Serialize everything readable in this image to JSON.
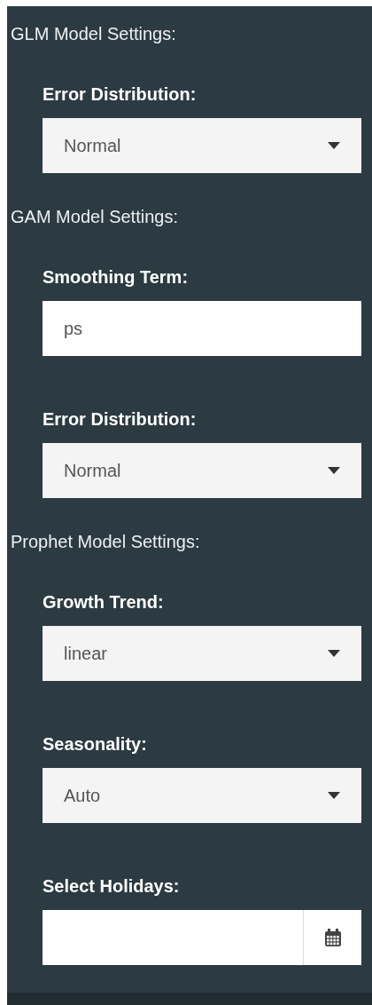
{
  "sections": [
    {
      "title": "GLM Model Settings:",
      "fields": [
        {
          "kind": "select",
          "label": "Error Distribution:",
          "value": "Normal"
        }
      ]
    },
    {
      "title": "GAM Model Settings:",
      "fields": [
        {
          "kind": "text",
          "label": "Smoothing Term:",
          "value": "ps"
        },
        {
          "kind": "select",
          "label": "Error Distribution:",
          "value": "Normal"
        }
      ]
    },
    {
      "title": "Prophet Model Settings:",
      "fields": [
        {
          "kind": "select",
          "label": "Growth Trend:",
          "value": "linear"
        },
        {
          "kind": "select",
          "label": "Seasonality:",
          "value": "Auto"
        },
        {
          "kind": "date",
          "label": "Select Holidays:"
        }
      ]
    }
  ]
}
